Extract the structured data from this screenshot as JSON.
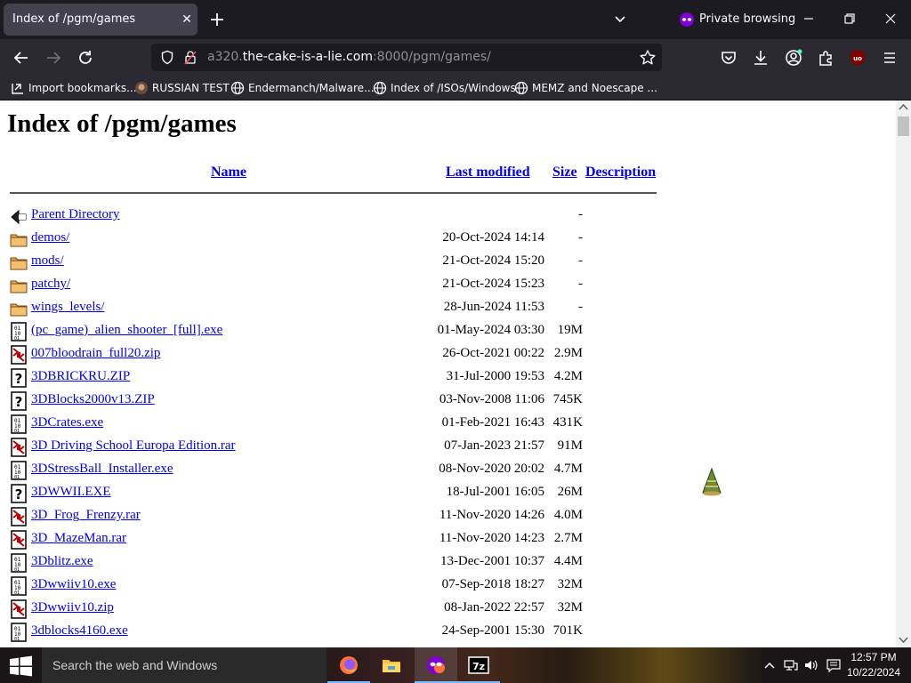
{
  "tab": {
    "title": "Index of /pgm/games",
    "close": "✕"
  },
  "private": {
    "label": "Private browsing"
  },
  "url": {
    "prefix": "a320.",
    "domain": "the-cake-is-a-lie.com",
    "suffix": ":8000/pgm/games/"
  },
  "bookmarks": [
    {
      "label": "Import bookmarks...",
      "icon": "import-icon"
    },
    {
      "label": "RUSSIAN TEST",
      "icon": "favicon-icon"
    },
    {
      "label": "Endermanch/Malware...",
      "icon": "globe-icon"
    },
    {
      "label": "Index of /ISOs/Windows",
      "icon": "globe-icon"
    },
    {
      "label": "MEMZ and Noescape ...",
      "icon": "globe-icon"
    }
  ],
  "listing": {
    "heading": "Index of /pgm/games",
    "columns": {
      "name": "Name",
      "modified": "Last modified",
      "size": "Size",
      "description": "Description"
    },
    "rows": [
      {
        "icon": "back",
        "name": "Parent Directory",
        "date": "",
        "size": "-"
      },
      {
        "icon": "folder",
        "name": "demos/",
        "date": "20-Oct-2024 14:14",
        "size": "-"
      },
      {
        "icon": "folder",
        "name": "mods/",
        "date": "21-Oct-2024 15:20",
        "size": "-"
      },
      {
        "icon": "folder",
        "name": "patchy/",
        "date": "21-Oct-2024 15:23",
        "size": "-"
      },
      {
        "icon": "folder",
        "name": "wings_levels/",
        "date": "28-Jun-2024 11:53",
        "size": "-"
      },
      {
        "icon": "binary",
        "name": "(pc_game)_alien_shooter_[full].exe",
        "date": "01-May-2024 03:30",
        "size": "19M"
      },
      {
        "icon": "archive",
        "name": "007bloodrain_full20.zip",
        "date": "26-Oct-2021 00:22",
        "size": "2.9M"
      },
      {
        "icon": "unknown",
        "name": "3DBRICKRU.ZIP",
        "date": "31-Jul-2000 19:53",
        "size": "4.2M"
      },
      {
        "icon": "unknown",
        "name": "3DBlocks2000v13.ZIP",
        "date": "03-Nov-2008 11:06",
        "size": "745K"
      },
      {
        "icon": "binary",
        "name": "3DCrates.exe",
        "date": "01-Feb-2021 16:43",
        "size": "431K"
      },
      {
        "icon": "archive",
        "name": "3D Driving School Europa Edition.rar",
        "date": "07-Jan-2023 21:57",
        "size": "91M"
      },
      {
        "icon": "binary",
        "name": "3DStressBall_Installer.exe",
        "date": "08-Nov-2020 20:02",
        "size": "4.7M"
      },
      {
        "icon": "unknown",
        "name": "3DWWII.EXE",
        "date": "18-Jul-2001 16:05",
        "size": "26M"
      },
      {
        "icon": "archive",
        "name": "3D_Frog_Frenzy.rar",
        "date": "11-Nov-2020 14:26",
        "size": "4.0M"
      },
      {
        "icon": "archive",
        "name": "3D_MazeMan.rar",
        "date": "11-Nov-2020 14:23",
        "size": "2.7M"
      },
      {
        "icon": "binary",
        "name": "3Dblitz.exe",
        "date": "13-Dec-2001 10:37",
        "size": "4.4M"
      },
      {
        "icon": "binary",
        "name": "3Dwwiiv10.exe",
        "date": "07-Sep-2018 18:27",
        "size": "32M"
      },
      {
        "icon": "archive",
        "name": "3Dwwiiv10.zip",
        "date": "08-Jan-2022 22:57",
        "size": "32M"
      },
      {
        "icon": "binary",
        "name": "3dblocks4160.exe",
        "date": "24-Sep-2001 15:30",
        "size": "701K"
      }
    ]
  },
  "taskbar": {
    "search_placeholder": "Search the web and Windows",
    "time": "12:57 PM",
    "date": "10/22/2024"
  },
  "colors": {
    "link": "#0000ee",
    "chrome_dark": "#1c1b22",
    "chrome": "#2b2a33",
    "private_purple": "#8000d7"
  }
}
